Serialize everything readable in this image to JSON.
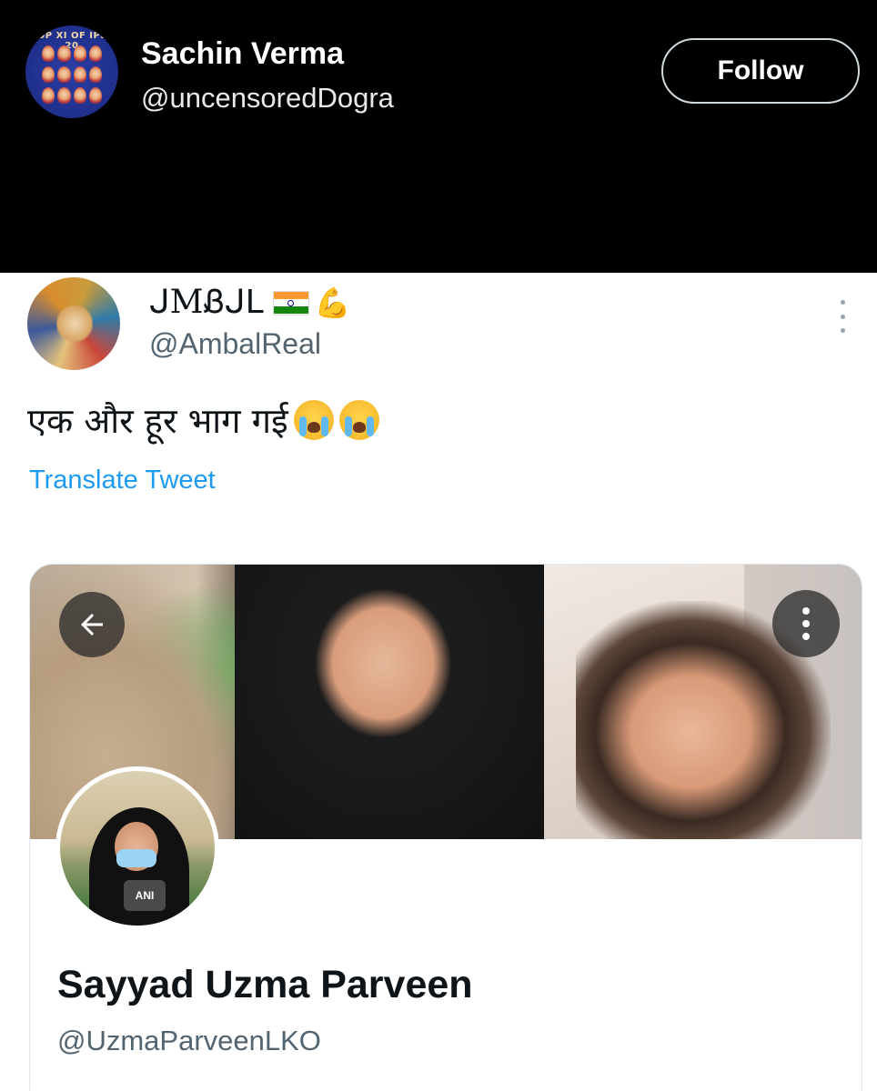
{
  "header": {
    "avatar_icon": "ipl-team-logo-avatar",
    "avatar_text": "OP XI OF IPL 20",
    "name": "Sachin Verma",
    "handle": "@uncensoredDogra",
    "follow_label": "Follow"
  },
  "tweet": {
    "author_name": "ᒍMᏰᒍᒪ",
    "author_emoji": [
      "india-flag-icon",
      "flexed-biceps-icon"
    ],
    "author_handle": "@AmbalReal",
    "text": "एक और हूर भाग गई",
    "text_emoji": [
      "loudly-crying-face-icon",
      "loudly-crying-face-icon"
    ],
    "translate_label": "Translate Tweet"
  },
  "media_card": {
    "profile_name": "Sayyad Uzma Parveen",
    "profile_handle": "@UzmaParveenLKO",
    "mic_label": "ANI"
  },
  "colors": {
    "header_bg": "#000000",
    "link": "#1d9bf0",
    "text_primary": "#0f1419",
    "text_secondary": "#536471"
  }
}
